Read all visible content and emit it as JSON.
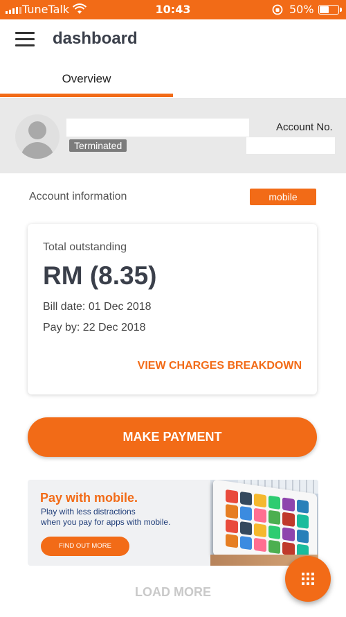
{
  "status_bar": {
    "carrier": "TuneTalk",
    "time": "10:43",
    "battery": "50%",
    "battery_level": 0.5
  },
  "header": {
    "title": "dashboard",
    "menu_icon": "hamburger-menu-icon"
  },
  "tabs": [
    {
      "label": "Overview",
      "active": true
    }
  ],
  "account": {
    "status": "Terminated",
    "account_no_label": "Account No."
  },
  "account_info": {
    "label": "Account information",
    "type_badge": "mobile"
  },
  "outstanding_card": {
    "label": "Total outstanding",
    "amount": "RM (8.35)",
    "bill_date": "Bill date: 01 Dec 2018",
    "pay_by": "Pay by: 22 Dec 2018",
    "view_charges": "VIEW CHARGES BREAKDOWN"
  },
  "make_payment": {
    "label": "MAKE PAYMENT"
  },
  "promo": {
    "title": "Pay with mobile.",
    "line1": "Play with less distractions",
    "line2": "when you pay for apps with mobile.",
    "button": "FIND OUT MORE"
  },
  "load_more": {
    "label": "LOAD MORE"
  },
  "colors": {
    "brand": "#f26b17",
    "status_badge": "#7c7c7c",
    "promo_text": "#1e3c78"
  }
}
